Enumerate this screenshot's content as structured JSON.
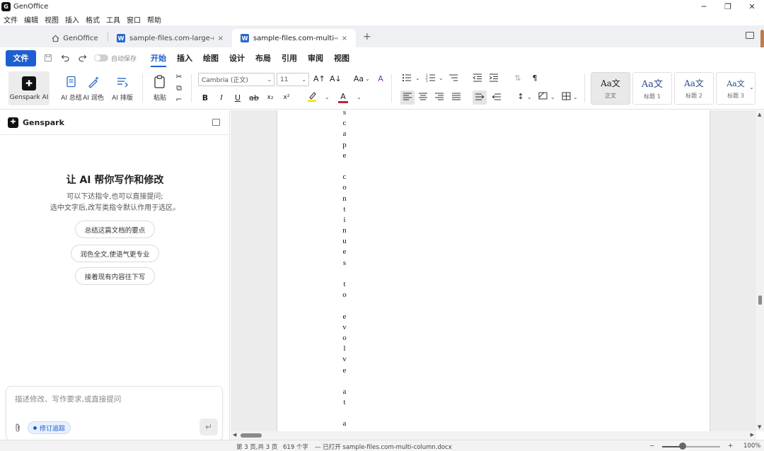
{
  "app": {
    "title": "GenOffice",
    "logo_glyph": "G"
  },
  "window_controls": {
    "minimize": "─",
    "restore": "❐",
    "close": "✕"
  },
  "menu": [
    "文件",
    "编辑",
    "视图",
    "插入",
    "格式",
    "工具",
    "窗口",
    "帮助"
  ],
  "tabs": {
    "home_label": "GenOffice",
    "doc1_label": "sample-files.com-large-docu…",
    "doc2_label": "sample-files.com-multi-colu…",
    "close_glyph": "×",
    "add_glyph": "+",
    "word_glyph": "W"
  },
  "ribbon_tabs": {
    "file": "文件",
    "autosave": "自动保存",
    "items": [
      "开始",
      "插入",
      "绘图",
      "设计",
      "布局",
      "引用",
      "审阅",
      "视图"
    ],
    "active_index": 0
  },
  "ribbon": {
    "genspark": "Genspark AI",
    "ai_summary": "AI 总结",
    "ai_polish": "AI 润色",
    "ai_layout": "AI 排版",
    "paste": "粘贴",
    "font_name": "Cambria (正文)",
    "font_size": "11",
    "grow_font": "A↑",
    "shrink_font": "A↓",
    "change_case": "Aa",
    "clear_format": "A",
    "bold": "B",
    "italic": "I",
    "underline": "U",
    "strike": "ab",
    "subscript": "x₂",
    "superscript": "x²",
    "font_color": "A",
    "pilcrow": "¶",
    "styles": [
      {
        "preview": "Aa文",
        "name": "正文"
      },
      {
        "preview": "Aa文",
        "name": "标题 1"
      },
      {
        "preview": "Aa文",
        "name": "标题 2"
      },
      {
        "preview": "Aa文",
        "name": "标题 3"
      }
    ],
    "colors": {
      "highlight": "#f2e200",
      "font_color": "#c0262d"
    }
  },
  "left_panel": {
    "title": "Genspark",
    "heading": "让 AI 帮你写作和修改",
    "sub1": "可以下达指令,也可以直接提问;",
    "sub2": "选中文字后,改写类指令默认作用于选区。",
    "chips": [
      "总结这篇文档的要点",
      "润色全文,使语气更专业",
      "接着现有内容往下写"
    ],
    "input_placeholder": "描述修改、写作要求,或直接提问",
    "track_changes": "修订追踪",
    "send_glyph": "↵"
  },
  "document": {
    "chars": [
      "s",
      "c",
      "a",
      "p",
      "e",
      "",
      "c",
      "o",
      "n",
      "t",
      "i",
      "n",
      "u",
      "e",
      "s",
      "",
      "t",
      "o",
      "",
      "e",
      "v",
      "o",
      "l",
      "v",
      "e",
      "",
      "a",
      "t",
      "",
      "a"
    ]
  },
  "status": {
    "page": "第 3 页,共 3 页",
    "words": "619 个字",
    "opened": "— 已打开 sample-files.com-multi-column.docx",
    "zoom_minus": "−",
    "zoom_plus": "+",
    "zoom": "100%",
    "zoom_level_fraction": 0.35
  },
  "accent_color": "#1d5fcf"
}
